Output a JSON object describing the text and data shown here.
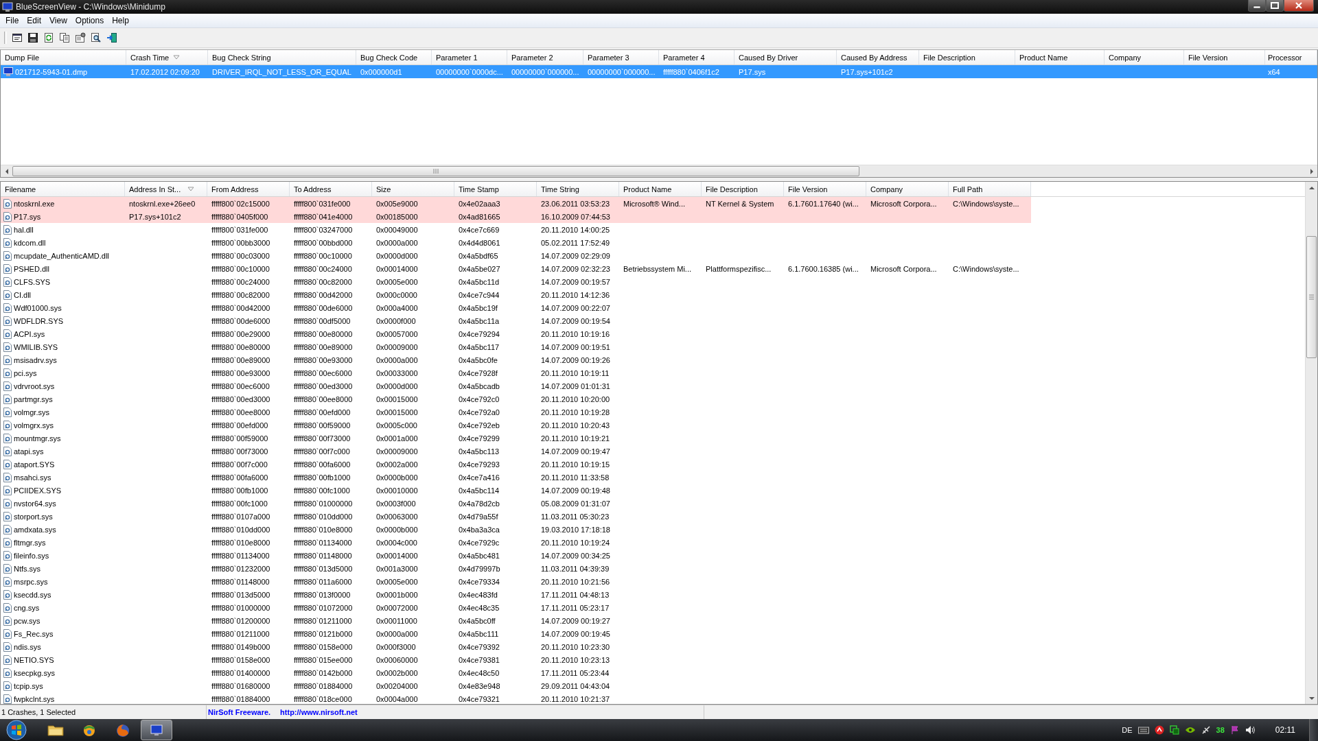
{
  "window": {
    "title": "BlueScreenView  -  C:\\Windows\\Minidump"
  },
  "menu": [
    "File",
    "Edit",
    "View",
    "Options",
    "Help"
  ],
  "toolbar": [
    {
      "kind": "properties"
    },
    {
      "kind": "save"
    },
    {
      "kind": "refresh"
    },
    {
      "kind": "copy"
    },
    {
      "kind": "options"
    },
    {
      "kind": "find"
    },
    {
      "kind": "exit"
    }
  ],
  "crash_list": {
    "columns": [
      {
        "label": "Dump File",
        "sorted": false
      },
      {
        "label": "Crash Time",
        "sorted": true
      },
      {
        "label": "Bug Check String",
        "sorted": false
      },
      {
        "label": "Bug Check Code",
        "sorted": false
      },
      {
        "label": "Parameter 1",
        "sorted": false
      },
      {
        "label": "Parameter 2",
        "sorted": false
      },
      {
        "label": "Parameter 3",
        "sorted": false
      },
      {
        "label": "Parameter 4",
        "sorted": false
      },
      {
        "label": "Caused By Driver",
        "sorted": false
      },
      {
        "label": "Caused By Address",
        "sorted": false
      },
      {
        "label": "File Description",
        "sorted": false
      },
      {
        "label": "Product Name",
        "sorted": false
      },
      {
        "label": "Company",
        "sorted": false
      },
      {
        "label": "File Version",
        "sorted": false
      },
      {
        "label": "Processor",
        "sorted": false
      }
    ],
    "rows": [
      {
        "selected": true,
        "cells": {
          "0": "021712-5943-01.dmp",
          "1": "17.02.2012 02:09:20",
          "2": "DRIVER_IRQL_NOT_LESS_OR_EQUAL",
          "3": "0x000000d1",
          "4": "00000000`0000dc...",
          "5": "00000000`000000...",
          "6": "00000000`000000...",
          "7": "fffff880`0406f1c2",
          "8": "P17.sys",
          "9": "P17.sys+101c2",
          "14": "x64"
        }
      }
    ]
  },
  "module_list": {
    "columns": [
      {
        "label": "Filename",
        "sorted": false
      },
      {
        "label": "Address In St...",
        "sorted": true
      },
      {
        "label": "From Address",
        "sorted": false
      },
      {
        "label": "To Address",
        "sorted": false
      },
      {
        "label": "Size",
        "sorted": false
      },
      {
        "label": "Time Stamp",
        "sorted": false
      },
      {
        "label": "Time String",
        "sorted": false
      },
      {
        "label": "Product Name",
        "sorted": false
      },
      {
        "label": "File Description",
        "sorted": false
      },
      {
        "label": "File Version",
        "sorted": false
      },
      {
        "label": "Company",
        "sorted": false
      },
      {
        "label": "Full Path",
        "sorted": false
      }
    ],
    "rows": [
      {
        "highlighted": true,
        "cells": {
          "0": "ntoskrnl.exe",
          "1": "ntoskrnl.exe+26ee0",
          "2": "fffff800`02c15000",
          "3": "fffff800`031fe000",
          "4": "0x005e9000",
          "5": "0x4e02aaa3",
          "6": "23.06.2011 03:53:23",
          "7": "Microsoft® Wind...",
          "8": "NT Kernel & System",
          "9": "6.1.7601.17640 (wi...",
          "10": "Microsoft Corpora...",
          "11": "C:\\Windows\\syste..."
        }
      },
      {
        "highlighted": true,
        "cells": {
          "0": "P17.sys",
          "1": "P17.sys+101c2",
          "2": "fffff880`0405f000",
          "3": "fffff880`041e4000",
          "4": "0x00185000",
          "5": "0x4ad81665",
          "6": "16.10.2009 07:44:53"
        }
      },
      {
        "highlighted": false,
        "cells": {
          "0": "hal.dll",
          "2": "fffff800`031fe000",
          "3": "fffff800`03247000",
          "4": "0x00049000",
          "5": "0x4ce7c669",
          "6": "20.11.2010 14:00:25"
        }
      },
      {
        "highlighted": false,
        "cells": {
          "0": "kdcom.dll",
          "2": "fffff800`00bb3000",
          "3": "fffff800`00bbd000",
          "4": "0x0000a000",
          "5": "0x4d4d8061",
          "6": "05.02.2011 17:52:49"
        }
      },
      {
        "highlighted": false,
        "cells": {
          "0": "mcupdate_AuthenticAMD.dll",
          "2": "fffff880`00c03000",
          "3": "fffff880`00c10000",
          "4": "0x0000d000",
          "5": "0x4a5bdf65",
          "6": "14.07.2009 02:29:09"
        }
      },
      {
        "highlighted": false,
        "cells": {
          "0": "PSHED.dll",
          "2": "fffff880`00c10000",
          "3": "fffff880`00c24000",
          "4": "0x00014000",
          "5": "0x4a5be027",
          "6": "14.07.2009 02:32:23",
          "7": "Betriebssystem Mi...",
          "8": "Plattformspezifisc...",
          "9": "6.1.7600.16385 (wi...",
          "10": "Microsoft Corpora...",
          "11": "C:\\Windows\\syste..."
        }
      },
      {
        "highlighted": false,
        "cells": {
          "0": "CLFS.SYS",
          "2": "fffff880`00c24000",
          "3": "fffff880`00c82000",
          "4": "0x0005e000",
          "5": "0x4a5bc11d",
          "6": "14.07.2009 00:19:57"
        }
      },
      {
        "highlighted": false,
        "cells": {
          "0": "CI.dll",
          "2": "fffff880`00c82000",
          "3": "fffff880`00d42000",
          "4": "0x000c0000",
          "5": "0x4ce7c944",
          "6": "20.11.2010 14:12:36"
        }
      },
      {
        "highlighted": false,
        "cells": {
          "0": "Wdf01000.sys",
          "2": "fffff880`00d42000",
          "3": "fffff880`00de6000",
          "4": "0x000a4000",
          "5": "0x4a5bc19f",
          "6": "14.07.2009 00:22:07"
        }
      },
      {
        "highlighted": false,
        "cells": {
          "0": "WDFLDR.SYS",
          "2": "fffff880`00de6000",
          "3": "fffff880`00df5000",
          "4": "0x0000f000",
          "5": "0x4a5bc11a",
          "6": "14.07.2009 00:19:54"
        }
      },
      {
        "highlighted": false,
        "cells": {
          "0": "ACPI.sys",
          "2": "fffff880`00e29000",
          "3": "fffff880`00e80000",
          "4": "0x00057000",
          "5": "0x4ce79294",
          "6": "20.11.2010 10:19:16"
        }
      },
      {
        "highlighted": false,
        "cells": {
          "0": "WMILIB.SYS",
          "2": "fffff880`00e80000",
          "3": "fffff880`00e89000",
          "4": "0x00009000",
          "5": "0x4a5bc117",
          "6": "14.07.2009 00:19:51"
        }
      },
      {
        "highlighted": false,
        "cells": {
          "0": "msisadrv.sys",
          "2": "fffff880`00e89000",
          "3": "fffff880`00e93000",
          "4": "0x0000a000",
          "5": "0x4a5bc0fe",
          "6": "14.07.2009 00:19:26"
        }
      },
      {
        "highlighted": false,
        "cells": {
          "0": "pci.sys",
          "2": "fffff880`00e93000",
          "3": "fffff880`00ec6000",
          "4": "0x00033000",
          "5": "0x4ce7928f",
          "6": "20.11.2010 10:19:11"
        }
      },
      {
        "highlighted": false,
        "cells": {
          "0": "vdrvroot.sys",
          "2": "fffff880`00ec6000",
          "3": "fffff880`00ed3000",
          "4": "0x0000d000",
          "5": "0x4a5bcadb",
          "6": "14.07.2009 01:01:31"
        }
      },
      {
        "highlighted": false,
        "cells": {
          "0": "partmgr.sys",
          "2": "fffff880`00ed3000",
          "3": "fffff880`00ee8000",
          "4": "0x00015000",
          "5": "0x4ce792c0",
          "6": "20.11.2010 10:20:00"
        }
      },
      {
        "highlighted": false,
        "cells": {
          "0": "volmgr.sys",
          "2": "fffff880`00ee8000",
          "3": "fffff880`00efd000",
          "4": "0x00015000",
          "5": "0x4ce792a0",
          "6": "20.11.2010 10:19:28"
        }
      },
      {
        "highlighted": false,
        "cells": {
          "0": "volmgrx.sys",
          "2": "fffff880`00efd000",
          "3": "fffff880`00f59000",
          "4": "0x0005c000",
          "5": "0x4ce792eb",
          "6": "20.11.2010 10:20:43"
        }
      },
      {
        "highlighted": false,
        "cells": {
          "0": "mountmgr.sys",
          "2": "fffff880`00f59000",
          "3": "fffff880`00f73000",
          "4": "0x0001a000",
          "5": "0x4ce79299",
          "6": "20.11.2010 10:19:21"
        }
      },
      {
        "highlighted": false,
        "cells": {
          "0": "atapi.sys",
          "2": "fffff880`00f73000",
          "3": "fffff880`00f7c000",
          "4": "0x00009000",
          "5": "0x4a5bc113",
          "6": "14.07.2009 00:19:47"
        }
      },
      {
        "highlighted": false,
        "cells": {
          "0": "ataport.SYS",
          "2": "fffff880`00f7c000",
          "3": "fffff880`00fa6000",
          "4": "0x0002a000",
          "5": "0x4ce79293",
          "6": "20.11.2010 10:19:15"
        }
      },
      {
        "highlighted": false,
        "cells": {
          "0": "msahci.sys",
          "2": "fffff880`00fa6000",
          "3": "fffff880`00fb1000",
          "4": "0x0000b000",
          "5": "0x4ce7a416",
          "6": "20.11.2010 11:33:58"
        }
      },
      {
        "highlighted": false,
        "cells": {
          "0": "PCIIDEX.SYS",
          "2": "fffff880`00fb1000",
          "3": "fffff880`00fc1000",
          "4": "0x00010000",
          "5": "0x4a5bc114",
          "6": "14.07.2009 00:19:48"
        }
      },
      {
        "highlighted": false,
        "cells": {
          "0": "nvstor64.sys",
          "2": "fffff880`00fc1000",
          "3": "fffff880`01000000",
          "4": "0x0003f000",
          "5": "0x4a78d2cb",
          "6": "05.08.2009 01:31:07"
        }
      },
      {
        "highlighted": false,
        "cells": {
          "0": "storport.sys",
          "2": "fffff880`0107a000",
          "3": "fffff880`010dd000",
          "4": "0x00063000",
          "5": "0x4d79a55f",
          "6": "11.03.2011 05:30:23"
        }
      },
      {
        "highlighted": false,
        "cells": {
          "0": "amdxata.sys",
          "2": "fffff880`010dd000",
          "3": "fffff880`010e8000",
          "4": "0x0000b000",
          "5": "0x4ba3a3ca",
          "6": "19.03.2010 17:18:18"
        }
      },
      {
        "highlighted": false,
        "cells": {
          "0": "fltmgr.sys",
          "2": "fffff880`010e8000",
          "3": "fffff880`01134000",
          "4": "0x0004c000",
          "5": "0x4ce7929c",
          "6": "20.11.2010 10:19:24"
        }
      },
      {
        "highlighted": false,
        "cells": {
          "0": "fileinfo.sys",
          "2": "fffff880`01134000",
          "3": "fffff880`01148000",
          "4": "0x00014000",
          "5": "0x4a5bc481",
          "6": "14.07.2009 00:34:25"
        }
      },
      {
        "highlighted": false,
        "cells": {
          "0": "Ntfs.sys",
          "2": "fffff880`01232000",
          "3": "fffff880`013d5000",
          "4": "0x001a3000",
          "5": "0x4d79997b",
          "6": "11.03.2011 04:39:39"
        }
      },
      {
        "highlighted": false,
        "cells": {
          "0": "msrpc.sys",
          "2": "fffff880`01148000",
          "3": "fffff880`011a6000",
          "4": "0x0005e000",
          "5": "0x4ce79334",
          "6": "20.11.2010 10:21:56"
        }
      },
      {
        "highlighted": false,
        "cells": {
          "0": "ksecdd.sys",
          "2": "fffff880`013d5000",
          "3": "fffff880`013f0000",
          "4": "0x0001b000",
          "5": "0x4ec483fd",
          "6": "17.11.2011 04:48:13"
        }
      },
      {
        "highlighted": false,
        "cells": {
          "0": "cng.sys",
          "2": "fffff880`01000000",
          "3": "fffff880`01072000",
          "4": "0x00072000",
          "5": "0x4ec48c35",
          "6": "17.11.2011 05:23:17"
        }
      },
      {
        "highlighted": false,
        "cells": {
          "0": "pcw.sys",
          "2": "fffff880`01200000",
          "3": "fffff880`01211000",
          "4": "0x00011000",
          "5": "0x4a5bc0ff",
          "6": "14.07.2009 00:19:27"
        }
      },
      {
        "highlighted": false,
        "cells": {
          "0": "Fs_Rec.sys",
          "2": "fffff880`01211000",
          "3": "fffff880`0121b000",
          "4": "0x0000a000",
          "5": "0x4a5bc111",
          "6": "14.07.2009 00:19:45"
        }
      },
      {
        "highlighted": false,
        "cells": {
          "0": "ndis.sys",
          "2": "fffff880`0149b000",
          "3": "fffff880`0158e000",
          "4": "0x000f3000",
          "5": "0x4ce79392",
          "6": "20.11.2010 10:23:30"
        }
      },
      {
        "highlighted": false,
        "cells": {
          "0": "NETIO.SYS",
          "2": "fffff880`0158e000",
          "3": "fffff880`015ee000",
          "4": "0x00060000",
          "5": "0x4ce79381",
          "6": "20.11.2010 10:23:13"
        }
      },
      {
        "highlighted": false,
        "cells": {
          "0": "ksecpkg.sys",
          "2": "fffff880`01400000",
          "3": "fffff880`0142b000",
          "4": "0x0002b000",
          "5": "0x4ec48c50",
          "6": "17.11.2011 05:23:44"
        }
      },
      {
        "highlighted": false,
        "cells": {
          "0": "tcpip.sys",
          "2": "fffff880`01680000",
          "3": "fffff880`01884000",
          "4": "0x00204000",
          "5": "0x4e83e948",
          "6": "29.09.2011 04:43:04"
        }
      },
      {
        "highlighted": false,
        "cells": {
          "0": "fwpkclnt.sys",
          "2": "fffff880`01884000",
          "3": "fffff880`018ce000",
          "4": "0x0004a000",
          "5": "0x4ce79321",
          "6": "20.11.2010 10:21:37"
        }
      }
    ]
  },
  "status_bar": {
    "summary": "1 Crashes, 1 Selected",
    "credit": "NirSoft Freeware.",
    "link": "http://www.nirsoft.net"
  },
  "taskbar": {
    "apps": [
      {
        "kind": "folder",
        "selected": false
      },
      {
        "kind": "ball",
        "selected": false
      },
      {
        "kind": "browser",
        "selected": false
      },
      {
        "kind": "monitor",
        "selected": true
      }
    ],
    "language": "DE",
    "tray_value": "38",
    "clock": "02:11"
  }
}
